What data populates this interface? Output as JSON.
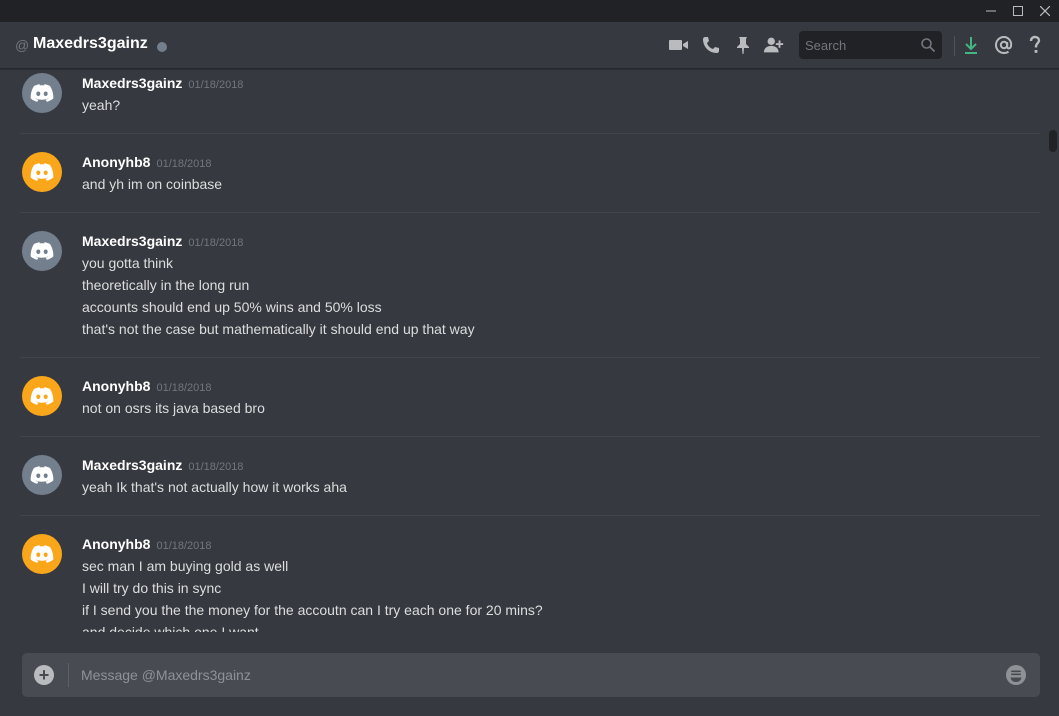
{
  "window": {
    "controls": [
      "minimize",
      "maximize",
      "close"
    ]
  },
  "header": {
    "at_symbol": "@",
    "title": "Maxedrs3gainz",
    "status": "offline",
    "icons": [
      "video-camera-icon",
      "phone-icon",
      "pin-icon",
      "add-friend-icon",
      "download-icon",
      "mention-icon",
      "help-icon"
    ],
    "search_placeholder": "Search"
  },
  "colors": {
    "background": "#36393f",
    "titlebar": "#202225",
    "input": "#484c52",
    "avatar_grey": "#747f8d",
    "avatar_orange": "#faa61a",
    "download_green": "#43b581"
  },
  "messages": [
    {
      "author": "Maxedrs3gainz",
      "avatar_color": "grey",
      "timestamp": "01/18/2018",
      "lines": [
        "yeah?"
      ]
    },
    {
      "author": "Anonyhb8",
      "avatar_color": "orange",
      "timestamp": "01/18/2018",
      "lines": [
        "and yh im on coinbase"
      ]
    },
    {
      "author": "Maxedrs3gainz",
      "avatar_color": "grey",
      "timestamp": "01/18/2018",
      "lines": [
        "you gotta think",
        "theoretically in the long run",
        "accounts should end up 50% wins and 50% loss",
        "that's not the case but mathematically it should end up that way"
      ]
    },
    {
      "author": "Anonyhb8",
      "avatar_color": "orange",
      "timestamp": "01/18/2018",
      "lines": [
        "not on osrs its java based bro"
      ]
    },
    {
      "author": "Maxedrs3gainz",
      "avatar_color": "grey",
      "timestamp": "01/18/2018",
      "lines": [
        "yeah Ik that's not actually how it works aha"
      ]
    },
    {
      "author": "Anonyhb8",
      "avatar_color": "orange",
      "timestamp": "01/18/2018",
      "lines": [
        "sec man I am buying gold as well",
        "I will try do this in sync",
        "if I send you the the money for the accoutn can I try each one for 20 mins?",
        "and decide which one I want"
      ]
    }
  ],
  "composer": {
    "placeholder": "Message @Maxedrs3gainz"
  }
}
